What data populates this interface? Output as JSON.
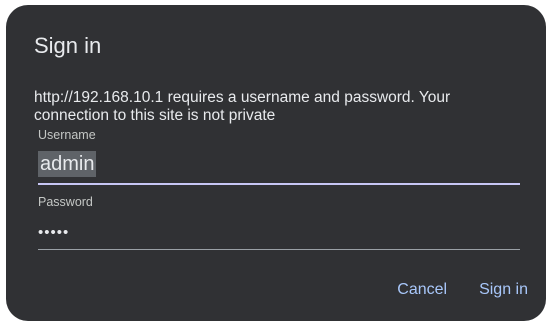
{
  "dialog": {
    "title": "Sign in",
    "message": "http://192.168.10.1 requires a username and password. Your connection to this site is not private"
  },
  "username": {
    "label": "Username",
    "value": "admin"
  },
  "password": {
    "label": "Password",
    "masked_value": "•••••"
  },
  "actions": {
    "cancel_label": "Cancel",
    "sign_in_label": "Sign in"
  },
  "colors": {
    "dialog_background": "#303134",
    "text": "#e8eaed",
    "accent": "#a8c7fa",
    "focused_underline": "#c7c6f4",
    "selection_highlight": "#5f6368"
  }
}
